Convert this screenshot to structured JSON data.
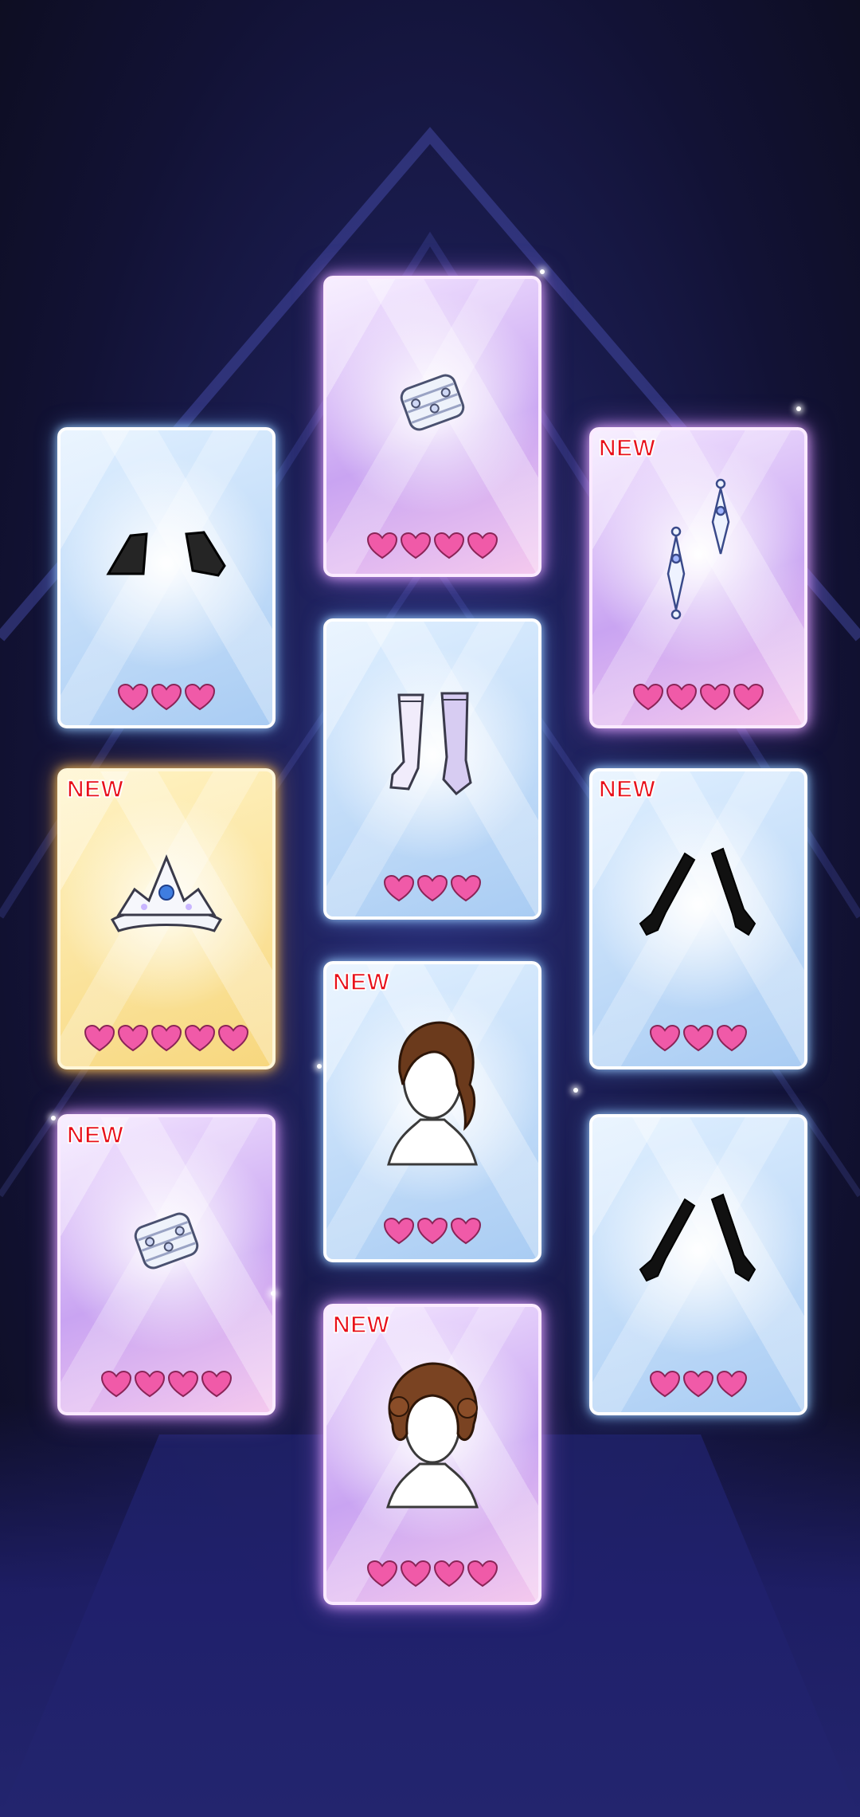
{
  "badge_label": "NEW",
  "colors": {
    "heart": "#f05aa8",
    "heart_outline": "#8a2457",
    "badge": "#e8101a",
    "rare_blue": "#a9ccf3",
    "rare_purple": "#c9a4f2",
    "rare_gold": "#f7d77e"
  },
  "cards": [
    {
      "item": "bracelet-icon",
      "rarity": "purple",
      "is_new": false,
      "hearts": 4
    },
    {
      "item": "wrist-cuffs-icon",
      "rarity": "blue",
      "is_new": false,
      "hearts": 3
    },
    {
      "item": "earrings-icon",
      "rarity": "purple",
      "is_new": true,
      "hearts": 4
    },
    {
      "item": "stockings-icon",
      "rarity": "blue",
      "is_new": false,
      "hearts": 3
    },
    {
      "item": "tiara-icon",
      "rarity": "gold",
      "is_new": true,
      "hearts": 5
    },
    {
      "item": "gloves-icon",
      "rarity": "blue",
      "is_new": true,
      "hearts": 3
    },
    {
      "item": "updo-hair-icon",
      "rarity": "blue",
      "is_new": true,
      "hearts": 3
    },
    {
      "item": "bracelet-icon",
      "rarity": "purple",
      "is_new": true,
      "hearts": 4
    },
    {
      "item": "gloves-icon",
      "rarity": "blue",
      "is_new": false,
      "hearts": 3
    },
    {
      "item": "curly-hair-icon",
      "rarity": "purple",
      "is_new": true,
      "hearts": 4
    }
  ]
}
